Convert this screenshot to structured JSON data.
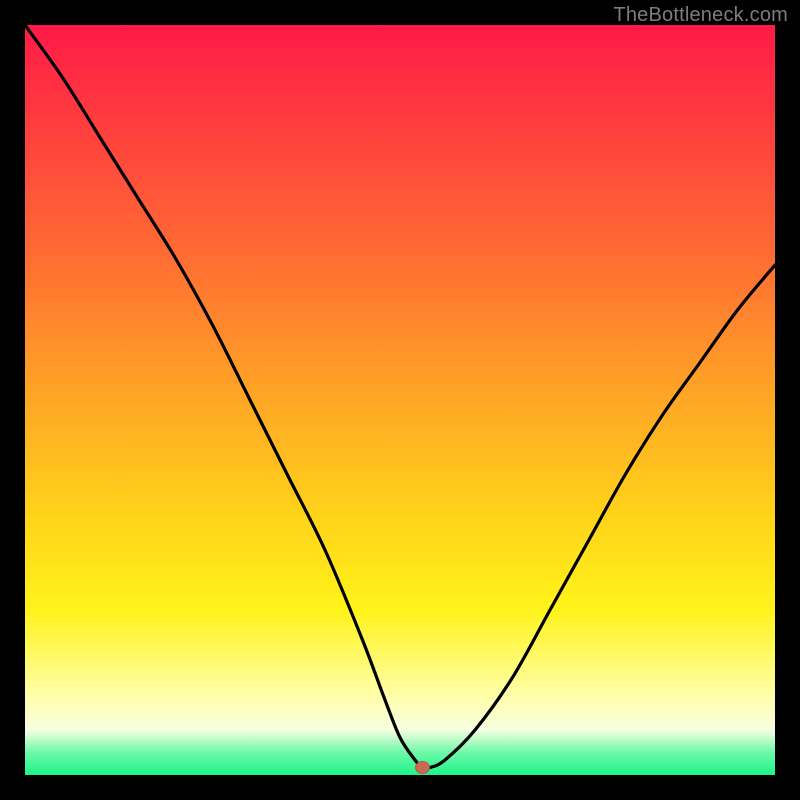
{
  "watermark": "TheBottleneck.com",
  "chart_data": {
    "type": "line",
    "title": "",
    "xlabel": "",
    "ylabel": "",
    "xlim": [
      0,
      100
    ],
    "ylim": [
      0,
      100
    ],
    "note": "Axes are unlabeled; values are normalized 0–100. The curve is a V-shaped bottleneck plot with a minimum near x≈53, matching the green band at the bottom.",
    "series": [
      {
        "name": "bottleneck-curve",
        "x": [
          0,
          5,
          10,
          15,
          20,
          25,
          30,
          35,
          40,
          45,
          48,
          50,
          52,
          53,
          54,
          56,
          60,
          65,
          70,
          75,
          80,
          85,
          90,
          95,
          100
        ],
        "values": [
          100,
          93,
          85,
          77,
          69,
          60,
          50,
          40,
          30,
          18,
          10,
          5,
          2,
          1,
          1,
          2,
          6,
          13,
          22,
          31,
          40,
          48,
          55,
          62,
          68
        ]
      }
    ],
    "min_marker": {
      "x": 53,
      "y": 1
    }
  },
  "colors": {
    "frame": "#000000",
    "grad_top": "#ff1a47",
    "grad_bottom": "#1ef38a",
    "curve": "#000000",
    "marker": "#c86a56"
  }
}
